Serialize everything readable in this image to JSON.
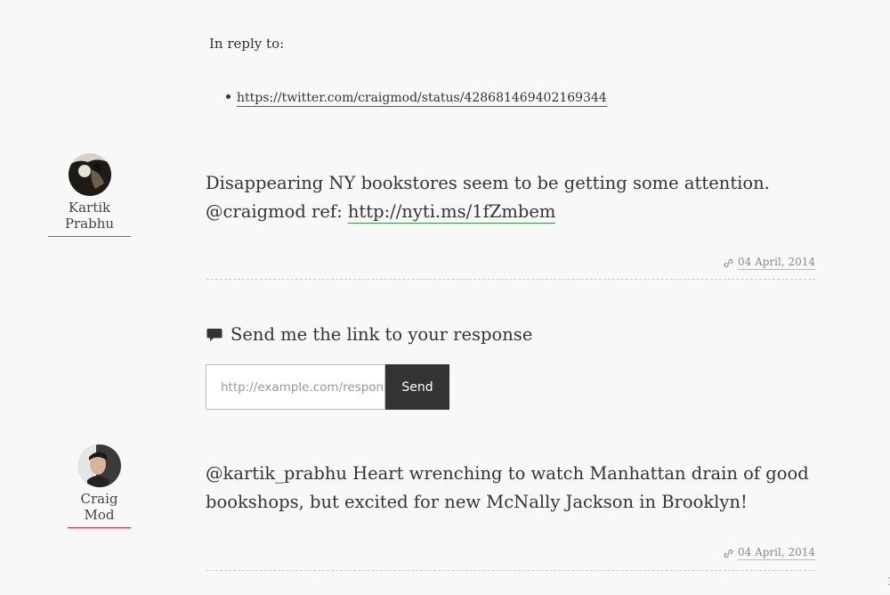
{
  "reply": {
    "label": "In reply to:",
    "links": [
      "https://twitter.com/craigmod/status/428681469402169344"
    ]
  },
  "entries": [
    {
      "author": "Kartik Prabhu",
      "avatar_icon": "avatar-silhouette",
      "text_prefix": "Disappearing NY bookstores seem to be getting some attention. @craigmod ref: ",
      "link": "http://nyti.ms/1fZmbem",
      "date": "04 April, 2014",
      "permalink_icon": "link-icon"
    },
    {
      "author": "Craig Mod",
      "avatar_icon": "avatar-portrait",
      "text": "@kartik_prabhu Heart wrenching to watch Manhattan drain of good bookshops, but excited for new McNally Jackson in Brooklyn!",
      "date": "04 April, 2014",
      "permalink_icon": "link-icon"
    }
  ],
  "response": {
    "title": "Send me the link to your response",
    "icon": "speech-bubble-icon",
    "placeholder": "http://example.com/response",
    "button": "Send"
  },
  "corner": "1",
  "colors": {
    "background": "#f8f8f8",
    "accent_red": "#c62d34",
    "accent_green": "#4a8a4a",
    "button_dark": "#333333"
  }
}
